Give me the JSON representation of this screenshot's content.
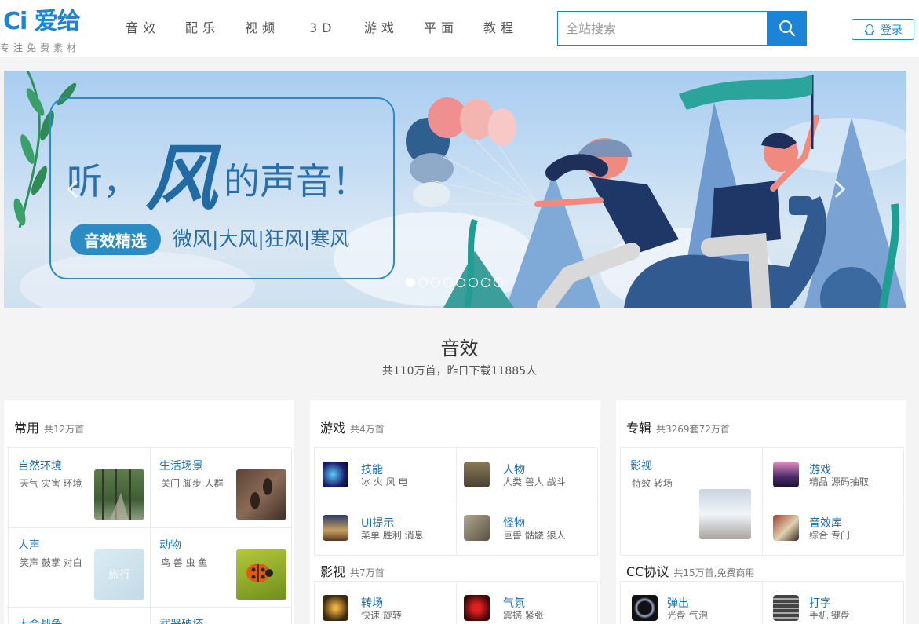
{
  "header": {
    "logo_mark": "Ci 爱给",
    "logo_sub": "专注免费素材",
    "nav": [
      "音效",
      "配乐",
      "视频",
      "3D",
      "游戏",
      "平面",
      "教程"
    ],
    "search_placeholder": "全站搜索",
    "login_label": "登录"
  },
  "banner": {
    "title_pre": "听，",
    "title_big": "风",
    "title_post": "的声音！",
    "tag": "音效精选",
    "words": "微风|大风|狂风|寒风",
    "slide_count": 8,
    "active_slide": 1
  },
  "section": {
    "title": "音效",
    "subtitle": "共110万首，昨日下载11885人"
  },
  "cards": {
    "common": {
      "title": "常用",
      "count": "共12万首",
      "items": [
        {
          "name": "自然环境",
          "tags": "天气 灾害 环境"
        },
        {
          "name": "生活场景",
          "tags": "关门 脚步 人群"
        },
        {
          "name": "人声",
          "tags": "笑声 鼓掌 对白"
        },
        {
          "name": "动物",
          "tags": "鸟 兽 虫 鱼"
        },
        {
          "name": "大会战争",
          "tags": ""
        },
        {
          "name": "武器破坏",
          "tags": ""
        }
      ],
      "thumb_text": "旅行"
    },
    "game": {
      "title": "游戏",
      "count": "共4万首",
      "items": [
        {
          "name": "技能",
          "tags": "冰 火 风 电"
        },
        {
          "name": "人物",
          "tags": "人类 兽人 战斗"
        },
        {
          "name": "UI提示",
          "tags": "菜单 胜利 消息"
        },
        {
          "name": "怪物",
          "tags": "巨兽 骷髅 狼人"
        }
      ],
      "sub": {
        "title": "影视",
        "count": "共7万首",
        "items": [
          {
            "name": "转场",
            "tags": "快速 旋转"
          },
          {
            "name": "气氛",
            "tags": "震撼 紧张"
          }
        ]
      }
    },
    "album": {
      "title": "专辑",
      "count": "共3269套72万首",
      "items": [
        {
          "name": "影视",
          "tags": "特效 转场"
        },
        {
          "name": "游戏",
          "tags": "精品 源码抽取"
        },
        {
          "name": "音效库",
          "tags": "综合 专门"
        }
      ],
      "sub": {
        "title": "CC协议",
        "count": "共15万首,免费商用",
        "items": [
          {
            "name": "弹出",
            "tags": "光盘 气泡"
          },
          {
            "name": "打字",
            "tags": "手机 键盘"
          }
        ]
      }
    }
  }
}
